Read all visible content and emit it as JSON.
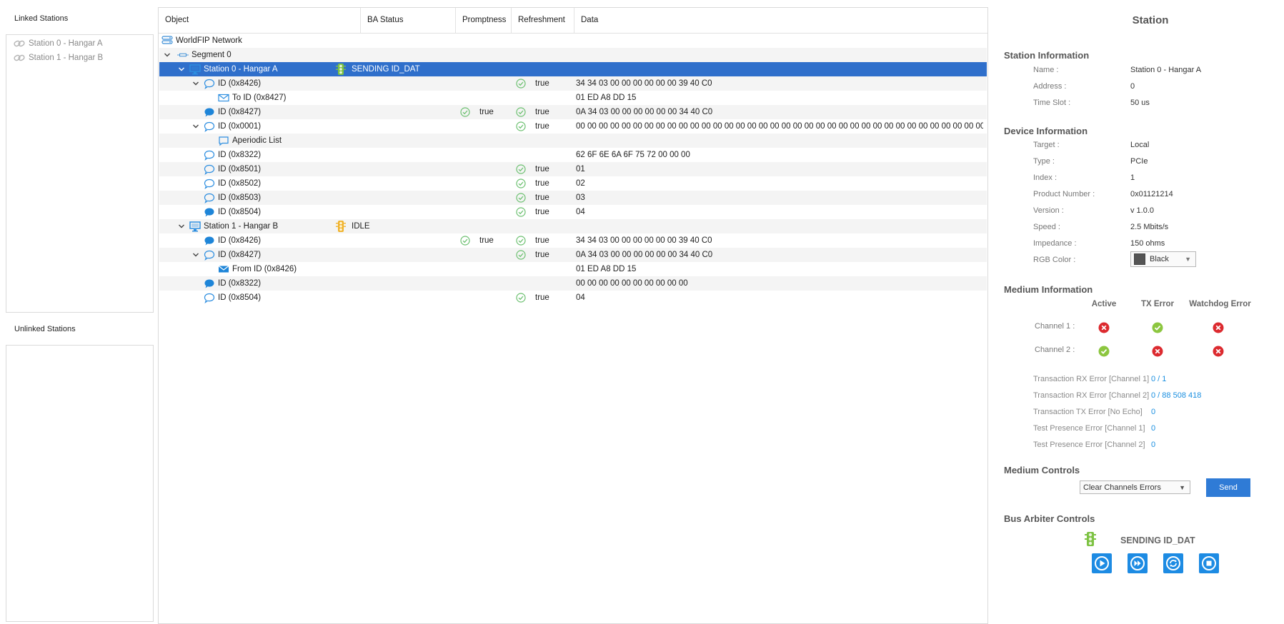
{
  "left": {
    "linked_title": "Linked Stations",
    "linked": [
      "Station 0 - Hangar A",
      "Station 1 - Hangar B"
    ],
    "unlinked_title": "Unlinked Stations"
  },
  "grid": {
    "columns": [
      "Object",
      "BA Status",
      "Promptness",
      "Refreshment",
      "Data"
    ],
    "rows": [
      {
        "label": "WorldFIP Network",
        "icon": "network-icon",
        "level": 0
      },
      {
        "label": "Segment 0",
        "icon": "segment-icon",
        "level": 1,
        "expanded": true
      },
      {
        "label": "Station 0 - Hangar A",
        "icon": "computer-icon",
        "level": 2,
        "expanded": true,
        "selected": true,
        "ba_status": "SENDING ID_DAT",
        "ba_icon": "traffic-light-green-icon"
      },
      {
        "label": "ID (0x8426)",
        "icon": "speech-bubble-outline-icon",
        "level": 3,
        "expanded": true,
        "refreshment": "true",
        "data": "34 34 03 00 00 00 00 00 00 39 40 C0"
      },
      {
        "label": "To ID (0x8427)",
        "icon": "envelope-icon",
        "level": 4,
        "data": "01 ED A8 DD 15"
      },
      {
        "label": "ID (0x8427)",
        "icon": "speech-bubble-filled-icon",
        "level": 3,
        "promptness": "true",
        "refreshment": "true",
        "data": "0A 34 03 00 00 00 00 00 00 34 40 C0"
      },
      {
        "label": "ID (0x0001)",
        "icon": "speech-bubble-outline-icon",
        "level": 3,
        "expanded": true,
        "refreshment": "true",
        "data": "00 00 00 00 00 00 00 00 00 00 00 00 00 00 00 00 00 00 00 00 00 00 00 00 00 00 00 00 00 00 00 00 00 00 00 00 00 00 00 00 00 00 00 00 00 00 00 00 00 00 00 ..."
      },
      {
        "label": "Aperiodic List",
        "icon": "list-box-icon",
        "level": 4
      },
      {
        "label": "ID (0x8322)",
        "icon": "speech-bubble-outline-icon",
        "level": 3,
        "data": "62 6F 6E 6A 6F 75 72 00 00 00"
      },
      {
        "label": "ID (0x8501)",
        "icon": "speech-bubble-outline-icon",
        "level": 3,
        "refreshment": "true",
        "data": "01"
      },
      {
        "label": "ID (0x8502)",
        "icon": "speech-bubble-outline-icon",
        "level": 3,
        "refreshment": "true",
        "data": "02"
      },
      {
        "label": "ID (0x8503)",
        "icon": "speech-bubble-outline-icon",
        "level": 3,
        "refreshment": "true",
        "data": "03"
      },
      {
        "label": "ID (0x8504)",
        "icon": "speech-bubble-filled-icon",
        "level": 3,
        "refreshment": "true",
        "data": "04"
      },
      {
        "label": "Station 1 - Hangar B",
        "icon": "computer-icon",
        "level": 2,
        "expanded": true,
        "ba_status": "IDLE",
        "ba_icon": "traffic-light-yellow-icon"
      },
      {
        "label": "ID (0x8426)",
        "icon": "speech-bubble-filled-icon",
        "level": 3,
        "promptness": "true",
        "refreshment": "true",
        "data": "34 34 03 00 00 00 00 00 00 39 40 C0"
      },
      {
        "label": "ID (0x8427)",
        "icon": "speech-bubble-outline-icon",
        "level": 3,
        "expanded": true,
        "refreshment": "true",
        "data": "0A 34 03 00 00 00 00 00 00 34 40 C0"
      },
      {
        "label": "From ID (0x8426)",
        "icon": "envelope-filled-icon",
        "level": 4,
        "data": "01 ED A8 DD 15"
      },
      {
        "label": "ID (0x8322)",
        "icon": "speech-bubble-filled-icon",
        "level": 3,
        "data": "00 00 00 00 00 00 00 00 00 00"
      },
      {
        "label": "ID (0x8504)",
        "icon": "speech-bubble-outline-icon",
        "level": 3,
        "refreshment": "true",
        "data": "04"
      }
    ]
  },
  "panel": {
    "title": "Station",
    "station_info": {
      "heading": "Station Information",
      "items": [
        {
          "k": "Name :",
          "v": "Station 0 - Hangar A"
        },
        {
          "k": "Address :",
          "v": "0"
        },
        {
          "k": "Time Slot :",
          "v": "50 us"
        }
      ]
    },
    "device_info": {
      "heading": "Device Information",
      "items": [
        {
          "k": "Target :",
          "v": "Local"
        },
        {
          "k": "Type :",
          "v": "PCIe"
        },
        {
          "k": "Index :",
          "v": "1"
        },
        {
          "k": "Product Number :",
          "v": "0x01121214"
        },
        {
          "k": "Version :",
          "v": "v 1.0.0"
        },
        {
          "k": "Speed :",
          "v": "2.5 Mbits/s"
        },
        {
          "k": "Impedance :",
          "v": "150 ohms"
        }
      ],
      "rgb_label": "RGB Color :",
      "rgb_value": "Black",
      "rgb_swatch": "#555555"
    },
    "medium_info": {
      "heading": "Medium Information",
      "columns": [
        "Active",
        "TX Error",
        "Watchdog Error"
      ],
      "channels": [
        {
          "label": "Channel 1 :",
          "states": [
            "error",
            "ok",
            "error"
          ]
        },
        {
          "label": "Channel 2 :",
          "states": [
            "ok",
            "error",
            "error"
          ]
        }
      ],
      "errors": [
        {
          "k": "Transaction RX Error [Channel 1]",
          "v": "0  /  1"
        },
        {
          "k": "Transaction RX Error [Channel 2]",
          "v": "0  /  88 508 418"
        },
        {
          "k": "Transaction TX Error [No Echo]",
          "v": "0"
        },
        {
          "k": "Test Presence Error [Channel 1]",
          "v": "0"
        },
        {
          "k": "Test Presence Error [Channel 2]",
          "v": "0"
        }
      ]
    },
    "medium_controls": {
      "heading": "Medium Controls",
      "select_value": "Clear Channels Errors",
      "send_label": "Send"
    },
    "bus_arbiter": {
      "heading": "Bus Arbiter Controls",
      "status": "SENDING ID_DAT",
      "buttons": [
        "play-icon",
        "fast-forward-icon",
        "refresh-icon",
        "stop-icon"
      ]
    },
    "colors": {
      "accent": "#2f6fcb",
      "ok": "#5cb85c",
      "error": "#d9232d",
      "link": "#1a8fe0"
    }
  }
}
